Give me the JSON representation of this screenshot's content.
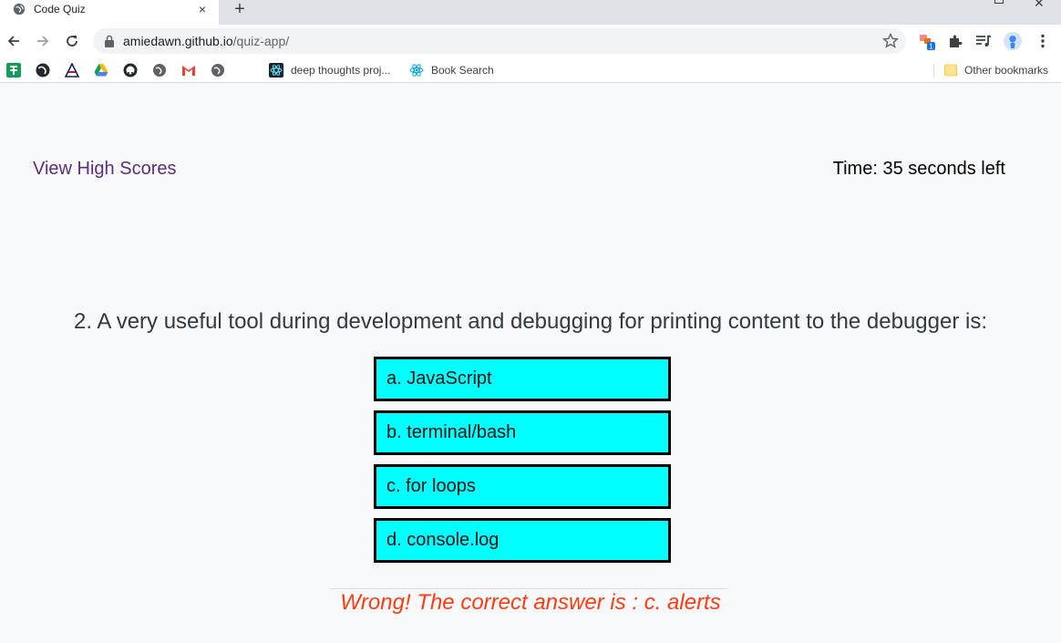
{
  "browser": {
    "tab": {
      "title": "Code Quiz",
      "close_glyph": "×",
      "favicon": "globe-icon"
    },
    "new_tab_glyph": "+",
    "url": {
      "host": "amiedawn.github.io",
      "path": "/quiz-app/"
    },
    "extensions": [
      "extension-badge-icon",
      "puzzle-icon",
      "media-queue-icon",
      "profile-avatar",
      "kebab-menu-icon"
    ],
    "extension_badge_count": "1",
    "bookmarks": {
      "items": [
        {
          "label": "deep thoughts proj..."
        },
        {
          "label": "Book Search"
        }
      ],
      "other": "Other bookmarks"
    }
  },
  "quiz": {
    "high_scores_label": "View High Scores",
    "timer_text": "Time: 35 seconds left",
    "question": "2. A very useful tool during development and debugging for printing content to the debugger is:",
    "answers": [
      "a. JavaScript",
      "b. terminal/bash",
      "c. for loops",
      "d. console.log"
    ],
    "feedback": "Wrong! The correct answer is : c. alerts"
  },
  "colors": {
    "answer_bg": "#00ffff",
    "feedback": "#ff3c14",
    "link": "#5c2d7a"
  }
}
